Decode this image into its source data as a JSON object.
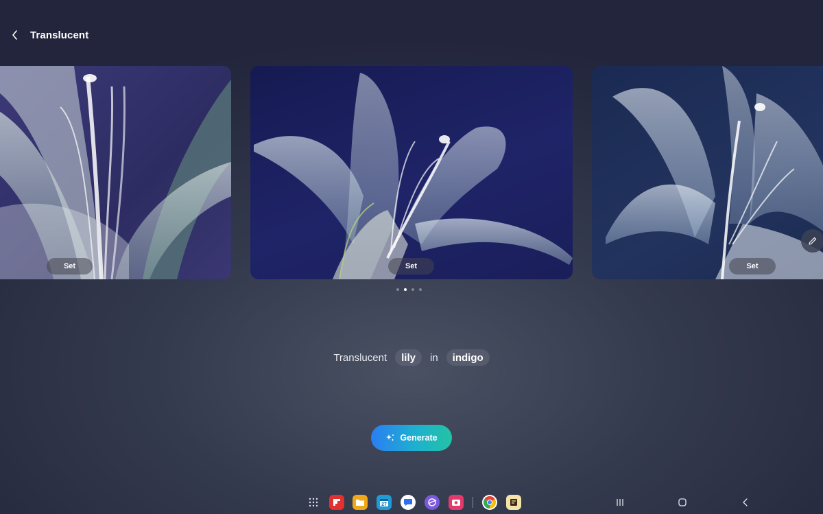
{
  "header": {
    "title": "Translucent"
  },
  "cards": [
    {
      "set_label": "Set"
    },
    {
      "set_label": "Set"
    },
    {
      "set_label": "Set"
    }
  ],
  "pagination": {
    "count": 4,
    "active_index": 1
  },
  "prompt": {
    "word1": "Translucent",
    "chip1": "lily",
    "word2": "in",
    "chip2": "indigo"
  },
  "generate": {
    "label": "Generate"
  },
  "taskbar": {
    "apps": [
      "apps-grid-icon",
      "flipboard-icon",
      "my-files-icon",
      "calendar-icon",
      "messages-icon",
      "internet-icon",
      "screen-recorder-icon",
      "chrome-icon",
      "notes-icon"
    ],
    "calendar_day": "27"
  },
  "colors": {
    "accent_start": "#2a7ef2",
    "accent_end": "#22c3a3"
  }
}
